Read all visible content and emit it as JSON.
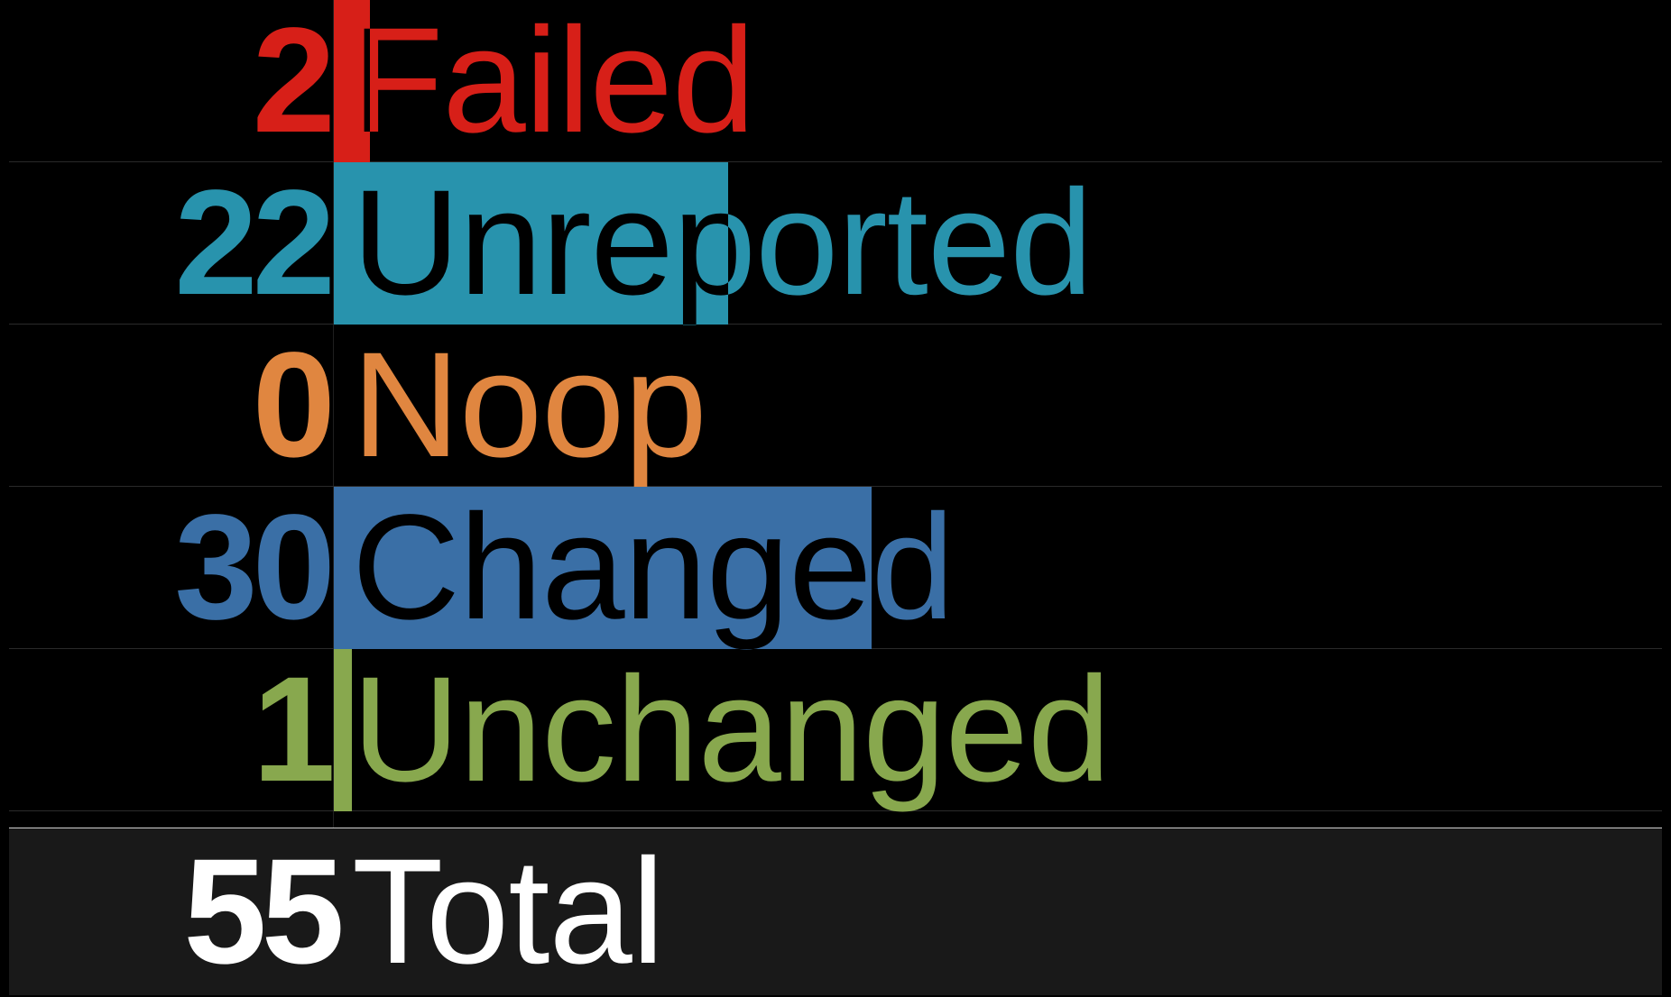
{
  "rows": [
    {
      "label": "Failed",
      "count": "2",
      "value": 2,
      "color": "#d71f18"
    },
    {
      "label": "Unreported",
      "count": "22",
      "value": 22,
      "color": "#2893ad"
    },
    {
      "label": "Noop",
      "count": "0",
      "value": 0,
      "color": "#e08640"
    },
    {
      "label": "Changed",
      "count": "30",
      "value": 30,
      "color": "#3a6fa6"
    },
    {
      "label": "Unchanged",
      "count": "1",
      "value": 1,
      "color": "#88a84e"
    }
  ],
  "total": {
    "label": "Total",
    "count": "55",
    "color": "#ffffff"
  },
  "scale_max": 55
}
